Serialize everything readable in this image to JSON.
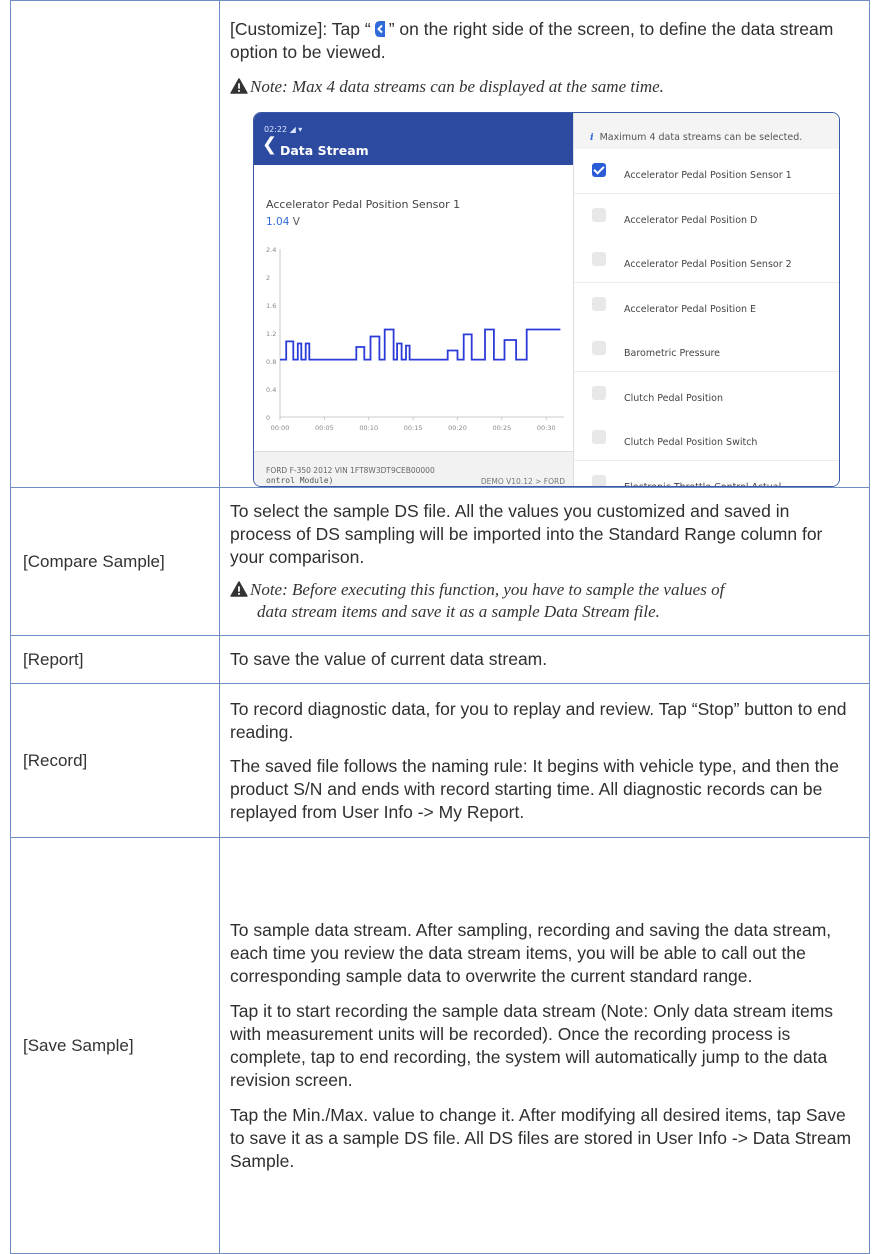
{
  "rows": {
    "customize": {
      "label": "",
      "text_before": "[Customize]: Tap “",
      "text_after": "” on the right side of the screen, to define the data stream option to be viewed.",
      "note": "Note: Max 4 data streams can be displayed at the same time.",
      "screenshot": {
        "status": "02:22 ◢ ▾",
        "title": "Data Stream",
        "sensor_name": "Accelerator Pedal Position Sensor 1",
        "value": "1.04",
        "unit": "V",
        "y_ticks": [
          "2.4",
          "2",
          "1.6",
          "1.2",
          "0.8",
          "0.4",
          "0"
        ],
        "x_ticks": [
          "00:00",
          "00:05",
          "00:10",
          "00:15",
          "00:20",
          "00:25",
          "00:30"
        ],
        "vehicle": "FORD  F-350  2012  VIN  1FT8W3DT9CEB00000",
        "module": "ontrol Module)",
        "demo": "DEMO V10.12 > FORD",
        "max_note": "Maximum 4 data streams can be selected.",
        "options": [
          {
            "label": "Accelerator Pedal Position Sensor 1",
            "checked": true
          },
          {
            "label": "Accelerator Pedal Position D",
            "checked": false
          },
          {
            "label": "Accelerator Pedal Position Sensor 2",
            "checked": false
          },
          {
            "label": "Accelerator Pedal Position E",
            "checked": false
          },
          {
            "label": "Barometric Pressure",
            "checked": false
          },
          {
            "label": "Clutch Pedal Position",
            "checked": false
          },
          {
            "label": "Clutch Pedal Position Switch",
            "checked": false
          },
          {
            "label": "Electronic Throttle Control Actual",
            "checked": false
          }
        ]
      }
    },
    "compare": {
      "label": "[Compare Sample]",
      "text": "To select the sample DS file. All the values you customized and saved in process of DS sampling will be imported into the Standard Range column for your comparison.",
      "note_line1": "Note: Before executing this function, you have to sample the values of",
      "note_line2": "data stream items and save it as a sample Data Stream file."
    },
    "report": {
      "label": "[Report]",
      "text": "To save the value of current data stream."
    },
    "record": {
      "label": "[Record]",
      "p1": "To record diagnostic data, for you to replay and review. Tap “Stop” button to end reading.",
      "p2": "The saved file follows the naming rule: It begins with vehicle type, and then the product S/N and ends with record starting time. All diagnostic records can be replayed from User Info -> My Report."
    },
    "save_sample": {
      "label": "[Save Sample]",
      "p1": "To sample data stream. After sampling, recording and saving the data stream, each time you review the data stream items, you will be able to call out the corresponding sample data to overwrite the current standard range.",
      "p2": "Tap it to start recording the sample data stream (Note: Only data stream items with measurement units will be recorded). Once the recording process is complete, tap to end recording, the system will automatically jump to the data revision screen.",
      "p3": "Tap the Min./Max. value to change it. After modifying all desired items, tap Save to save it as a sample DS file. All DS files are stored in User Info -> Data Stream Sample."
    }
  },
  "colors": {
    "table_border": "#6f8fc4",
    "header_blue": "#2b4aa0",
    "plot_line": "#2b3bd8",
    "accent_blue": "#2b5bd7"
  },
  "chart_data": {
    "type": "line",
    "title": "",
    "xlabel": "",
    "ylabel": "",
    "x_ticks": [
      "00:00",
      "00:05",
      "00:10",
      "00:15",
      "00:20",
      "00:25",
      "00:30"
    ],
    "ylim": [
      0,
      2.4
    ],
    "xlim": [
      0,
      32
    ],
    "series": [
      {
        "values_x": [
          0,
          0.7,
          0.7,
          1.5,
          1.5,
          2.0,
          2.0,
          2.4,
          2.4,
          2.9,
          2.9,
          3.3,
          3.3,
          3.8,
          3.8,
          8.6,
          8.6,
          9.5,
          9.5,
          10.2,
          10.2,
          11.2,
          11.2,
          11.8,
          11.8,
          12.8,
          12.8,
          13.2,
          13.2,
          13.7,
          13.7,
          14.2,
          14.2,
          14.6,
          14.6,
          18.9,
          18.9,
          20.0,
          20.0,
          20.7,
          20.7,
          21.6,
          21.6,
          23.1,
          23.1,
          24.1,
          24.1,
          25.3,
          25.3,
          26.6,
          26.6,
          27.8,
          27.8,
          31.6
        ],
        "values_y": [
          0.82,
          0.82,
          1.08,
          1.08,
          0.82,
          0.82,
          1.05,
          1.05,
          0.82,
          0.82,
          1.05,
          1.05,
          0.82,
          0.82,
          0.82,
          0.82,
          1.0,
          1.0,
          0.82,
          0.82,
          1.15,
          1.15,
          0.82,
          0.82,
          1.25,
          1.25,
          0.82,
          0.82,
          1.05,
          1.05,
          0.82,
          0.82,
          1.02,
          1.02,
          0.82,
          0.82,
          0.95,
          0.95,
          0.82,
          0.82,
          1.18,
          1.18,
          0.82,
          0.82,
          1.25,
          1.25,
          0.82,
          0.82,
          1.1,
          1.1,
          0.82,
          0.82,
          1.25,
          1.25
        ]
      }
    ],
    "grid": false,
    "legend": "none"
  }
}
